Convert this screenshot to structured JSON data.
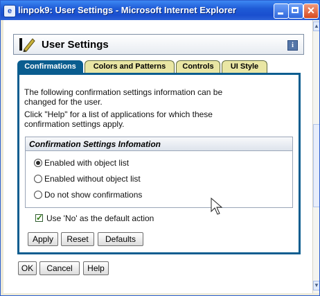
{
  "window": {
    "title": "linpok9: User Settings - Microsoft Internet Explorer"
  },
  "portlet": {
    "title": "User Settings"
  },
  "tabs": [
    {
      "label": "Confirmations",
      "active": true
    },
    {
      "label": "Colors and Patterns",
      "active": false
    },
    {
      "label": "Controls",
      "active": false
    },
    {
      "label": "UI Style",
      "active": false
    }
  ],
  "content": {
    "description_lines": [
      "The following confirmation settings information can be",
      "changed for the user.",
      "Click \"Help\" for a list of applications for which these",
      "confirmation settings apply."
    ],
    "section_header": "Confirmation Settings Infomation",
    "radio_options": [
      {
        "label": "Enabled with object list",
        "selected": true
      },
      {
        "label": "Enabled without object list",
        "selected": false
      },
      {
        "label": "Do not show confirmations",
        "selected": false
      }
    ],
    "checkbox": {
      "label": "Use 'No' as the default action",
      "checked": true
    }
  },
  "panel_buttons": {
    "apply": "Apply",
    "reset": "Reset",
    "defaults": "Defaults"
  },
  "dialog_buttons": {
    "ok": "OK",
    "cancel": "Cancel",
    "help": "Help"
  },
  "colors": {
    "titlebar": "#1f5bd6",
    "active_tab": "#0a5d8f",
    "inactive_tab": "#e9e6a4"
  },
  "icons": [
    "ie-icon",
    "minimize-icon",
    "maximize-icon",
    "close-icon",
    "pencil-icon",
    "info-icon",
    "mouse-cursor-icon"
  ]
}
